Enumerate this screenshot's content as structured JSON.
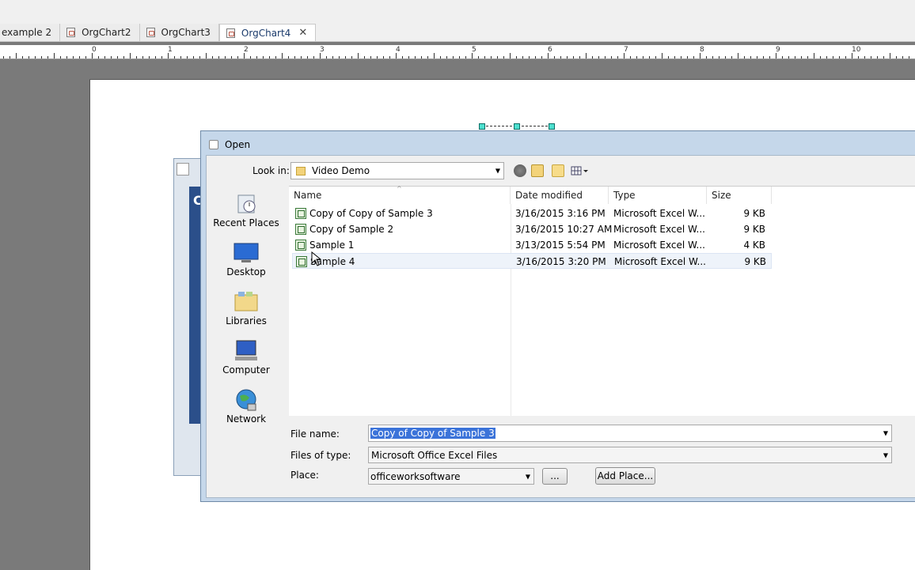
{
  "tabs": [
    {
      "label": "example 2",
      "active": false
    },
    {
      "label": "OrgChart2",
      "active": false
    },
    {
      "label": "OrgChart3",
      "active": false
    },
    {
      "label": "OrgChart4",
      "active": true
    }
  ],
  "tab_close": "✕",
  "ruler": {
    "numbers": [
      "0",
      "1",
      "2",
      "3",
      "4",
      "5",
      "6",
      "7",
      "8",
      "9",
      "10"
    ]
  },
  "background_window": {
    "letter": "C"
  },
  "dialog": {
    "title": "Open",
    "look_in_label": "Look in:",
    "look_in_value": "Video Demo",
    "places": [
      {
        "label": "Recent Places",
        "icon": "recent-places-icon"
      },
      {
        "label": "Desktop",
        "icon": "desktop-icon"
      },
      {
        "label": "Libraries",
        "icon": "libraries-icon"
      },
      {
        "label": "Computer",
        "icon": "computer-icon"
      },
      {
        "label": "Network",
        "icon": "network-icon"
      }
    ],
    "columns": [
      "Name",
      "Date modified",
      "Type",
      "Size"
    ],
    "files": [
      {
        "name": "Copy of Copy of Sample 3",
        "date": "3/16/2015 3:16 PM",
        "type": "Microsoft Excel W...",
        "size": "9 KB"
      },
      {
        "name": "Copy of Sample 2",
        "date": "3/16/2015 10:27 AM",
        "type": "Microsoft Excel W...",
        "size": "9 KB"
      },
      {
        "name": "Sample 1",
        "date": "3/13/2015 5:54 PM",
        "type": "Microsoft Excel W...",
        "size": "4 KB"
      },
      {
        "name": "Sample 4",
        "date": "3/16/2015 3:20 PM",
        "type": "Microsoft Excel W...",
        "size": "9 KB"
      }
    ],
    "file_name_label": "File name:",
    "file_name_value": "Copy of Copy of Sample 3",
    "files_of_type_label": "Files of type:",
    "files_of_type_value": "Microsoft Office Excel Files",
    "place_label": "Place:",
    "place_value": "officeworksoftware",
    "browse_button": "...",
    "add_place_button": "Add Place..."
  }
}
